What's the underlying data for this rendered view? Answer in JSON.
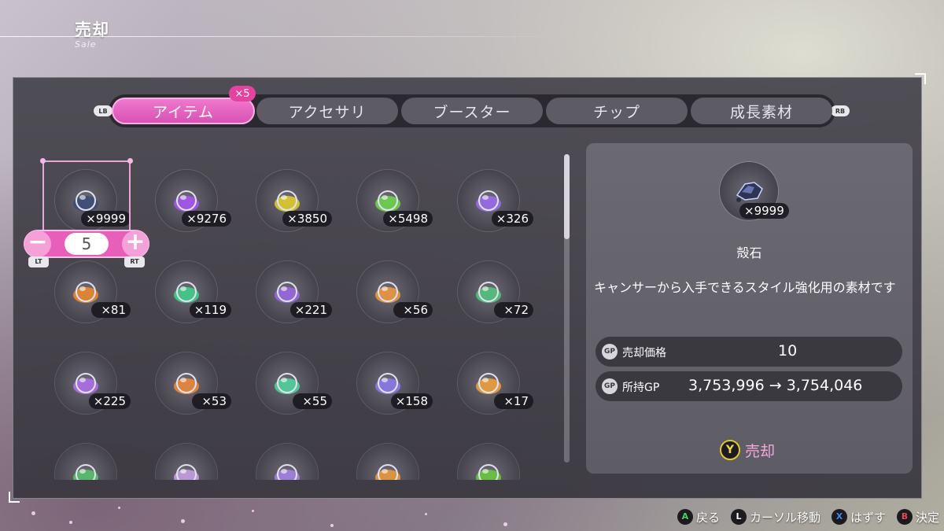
{
  "header": {
    "title": "売却",
    "subtitle": "Sale"
  },
  "tabs": {
    "lb": "LB",
    "rb": "RB",
    "items": [
      {
        "label": "アイテム",
        "active": true
      },
      {
        "label": "アクセサリ",
        "active": false
      },
      {
        "label": "ブースター",
        "active": false
      },
      {
        "label": "チップ",
        "active": false
      },
      {
        "label": "成長素材",
        "active": false
      }
    ],
    "badge": "×5"
  },
  "stepper": {
    "minus": "−",
    "plus": "+",
    "value": "5",
    "lt": "LT",
    "rt": "RT"
  },
  "items": [
    {
      "icon": "shell-stone-icon",
      "qty": "×9999",
      "color": "#3b4a78"
    },
    {
      "icon": "purple-vial-icon",
      "qty": "×9276",
      "color": "#a855f7"
    },
    {
      "icon": "yellow-vial-icon",
      "qty": "×3850",
      "color": "#e5d02a"
    },
    {
      "icon": "green-vial-icon",
      "qty": "×5498",
      "color": "#6fd84a"
    },
    {
      "icon": "purple-dish-icon",
      "qty": "×326",
      "color": "#9b6cf2"
    },
    {
      "icon": "orange-dish-icon",
      "qty": "×81",
      "color": "#f08a2a"
    },
    {
      "icon": "green-dish-icon",
      "qty": "×119",
      "color": "#3fd28b"
    },
    {
      "icon": "purple-crystal-flask-icon",
      "qty": "×221",
      "color": "#9a67e6"
    },
    {
      "icon": "orange-crystal-flask-icon",
      "qty": "×56",
      "color": "#f39a3e"
    },
    {
      "icon": "green-crystal-flask-icon",
      "qty": "×72",
      "color": "#53c77f"
    },
    {
      "icon": "purple-cartridge-case-icon",
      "qty": "×225",
      "color": "#b070f0"
    },
    {
      "icon": "orange-cartridge-case-icon",
      "qty": "×53",
      "color": "#f28a3a"
    },
    {
      "icon": "green-cartridge-case-icon",
      "qty": "×55",
      "color": "#4fd7a0"
    },
    {
      "icon": "purple-orb-icon",
      "qty": "×158",
      "color": "#8d7af0"
    },
    {
      "icon": "orange-orb-icon",
      "qty": "×17",
      "color": "#f4a23a"
    },
    {
      "icon": "green-sphere-icon",
      "qty": "",
      "color": "#58c46b"
    },
    {
      "icon": "rainbow-shard-icon",
      "qty": "",
      "color": "#c9a1e8"
    },
    {
      "icon": "purple-drop-icon",
      "qty": "",
      "color": "#a684e8"
    },
    {
      "icon": "orange-drop-icon",
      "qty": "",
      "color": "#f09a3c"
    },
    {
      "icon": "green-drop-icon",
      "qty": "",
      "color": "#6acb3f"
    }
  ],
  "detail": {
    "qty": "×9999",
    "name": "殻石",
    "description": "キャンサーから入手できるスタイル強化用の素材です",
    "price_label": "売却価格",
    "price_value": "10",
    "gp_icon": "GP",
    "owned_label": "所持GP",
    "owned_value": "3,753,996 → 3,754,046",
    "sell_button": "Y",
    "sell_label": "売却"
  },
  "hints": [
    {
      "key": "A",
      "label": "戻る",
      "color": "#4ad06a"
    },
    {
      "key": "L",
      "label": "カーソル移動",
      "color": "#ffffff"
    },
    {
      "key": "X",
      "label": "はずす",
      "color": "#3e8bf0"
    },
    {
      "key": "B",
      "label": "決定",
      "color": "#e8474f"
    }
  ],
  "colors": {
    "accent": "#e85fba",
    "panel": "#45434c",
    "sell": "#f6a7df"
  }
}
